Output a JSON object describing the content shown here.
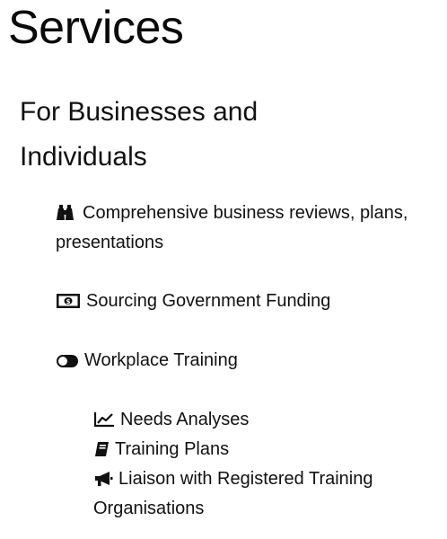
{
  "page": {
    "title": "Services"
  },
  "section": {
    "heading": "For Businesses and Individuals"
  },
  "services": [
    {
      "icon": "binoculars-icon",
      "label": "Comprehensive business reviews, plans, presentations"
    },
    {
      "icon": "money-bill-icon",
      "label": "Sourcing Government Funding"
    },
    {
      "icon": "toggle-icon",
      "label": "Workplace Training"
    }
  ],
  "training_items": [
    {
      "icon": "line-chart-icon",
      "label": "Needs Analyses"
    },
    {
      "icon": "book-icon",
      "label": "Training Plans"
    },
    {
      "icon": "bullhorn-icon",
      "label": "Liaison with Registered Training Organisations"
    }
  ]
}
